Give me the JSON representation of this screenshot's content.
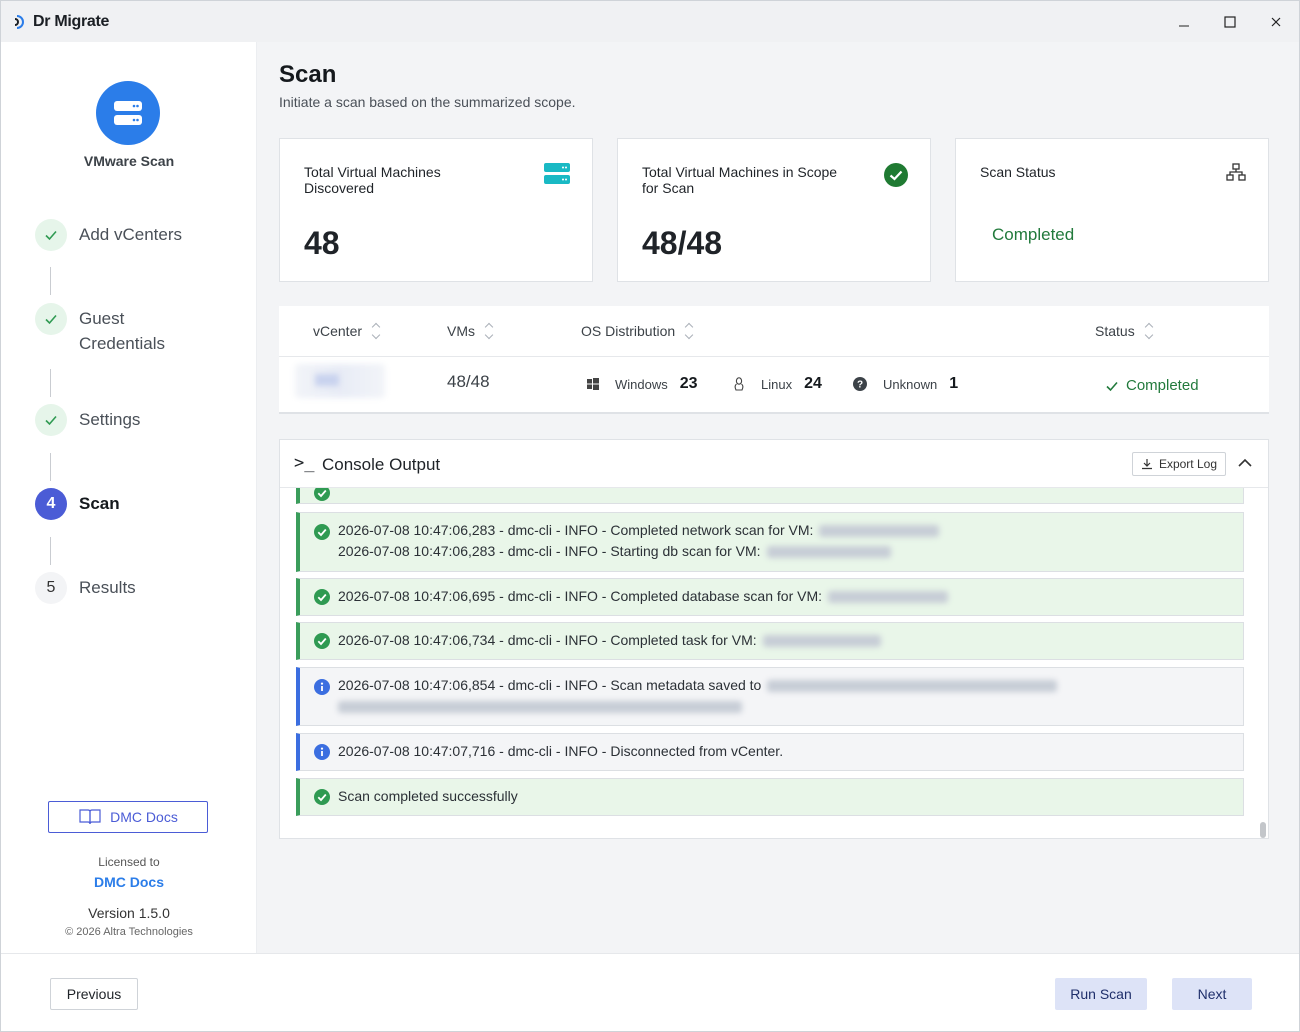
{
  "window": {
    "title": "Dr Migrate"
  },
  "sidebar": {
    "brand_label": "VMware Scan",
    "steps": [
      {
        "label": "Add vCenters",
        "state": "done"
      },
      {
        "label": "Guest Credentials",
        "state": "done"
      },
      {
        "label": "Settings",
        "state": "done"
      },
      {
        "label": "Scan",
        "number": "4",
        "state": "active"
      },
      {
        "label": "Results",
        "number": "5",
        "state": "todo"
      }
    ],
    "docs_button": "DMC Docs",
    "licensed_to_label": "Licensed to",
    "licensee": "DMC Docs",
    "version": "Version 1.5.0",
    "copyright": "© 2026 Altra Technologies"
  },
  "header": {
    "title": "Scan",
    "subtitle": "Initiate a scan based on the summarized scope."
  },
  "cards": [
    {
      "title": "Total Virtual Machines Discovered",
      "value": "48"
    },
    {
      "title": "Total Virtual Machines in Scope for Scan",
      "value": "48/48"
    },
    {
      "title": "Scan Status",
      "value": "Completed"
    }
  ],
  "table": {
    "columns": [
      "vCenter",
      "VMs",
      "OS Distribution",
      "Status"
    ],
    "row": {
      "vms": "48/48",
      "os": [
        {
          "name": "Windows",
          "count": "23"
        },
        {
          "name": "Linux",
          "count": "24"
        },
        {
          "name": "Unknown",
          "count": "1"
        }
      ],
      "status": "Completed"
    }
  },
  "console": {
    "title": "Console Output",
    "export_label": "Export Log",
    "logs": [
      {
        "type": "success",
        "lines": [
          "2026-07-08 10:47:06,283 - dmc-cli - INFO - Completed network scan for VM:",
          "2026-07-08 10:47:06,283 - dmc-cli - INFO - Starting db scan for VM:"
        ]
      },
      {
        "type": "success",
        "lines": [
          "2026-07-08 10:47:06,695 - dmc-cli - INFO - Completed database scan for VM:"
        ]
      },
      {
        "type": "success",
        "lines": [
          "2026-07-08 10:47:06,734 - dmc-cli - INFO - Completed task for VM:"
        ]
      },
      {
        "type": "info",
        "lines": [
          "2026-07-08 10:47:06,854 - dmc-cli - INFO - Scan metadata saved to"
        ]
      },
      {
        "type": "info",
        "lines": [
          "2026-07-08 10:47:07,716 - dmc-cli - INFO - Disconnected from vCenter."
        ]
      },
      {
        "type": "success",
        "lines": [
          "Scan completed successfully"
        ]
      }
    ]
  },
  "footer": {
    "previous": "Previous",
    "run_scan": "Run Scan",
    "next": "Next"
  },
  "colors": {
    "accent": "#4b5cd6",
    "brand_blue": "#2b7de9",
    "success": "#227a3c",
    "success_bg": "#e9f6e9"
  }
}
